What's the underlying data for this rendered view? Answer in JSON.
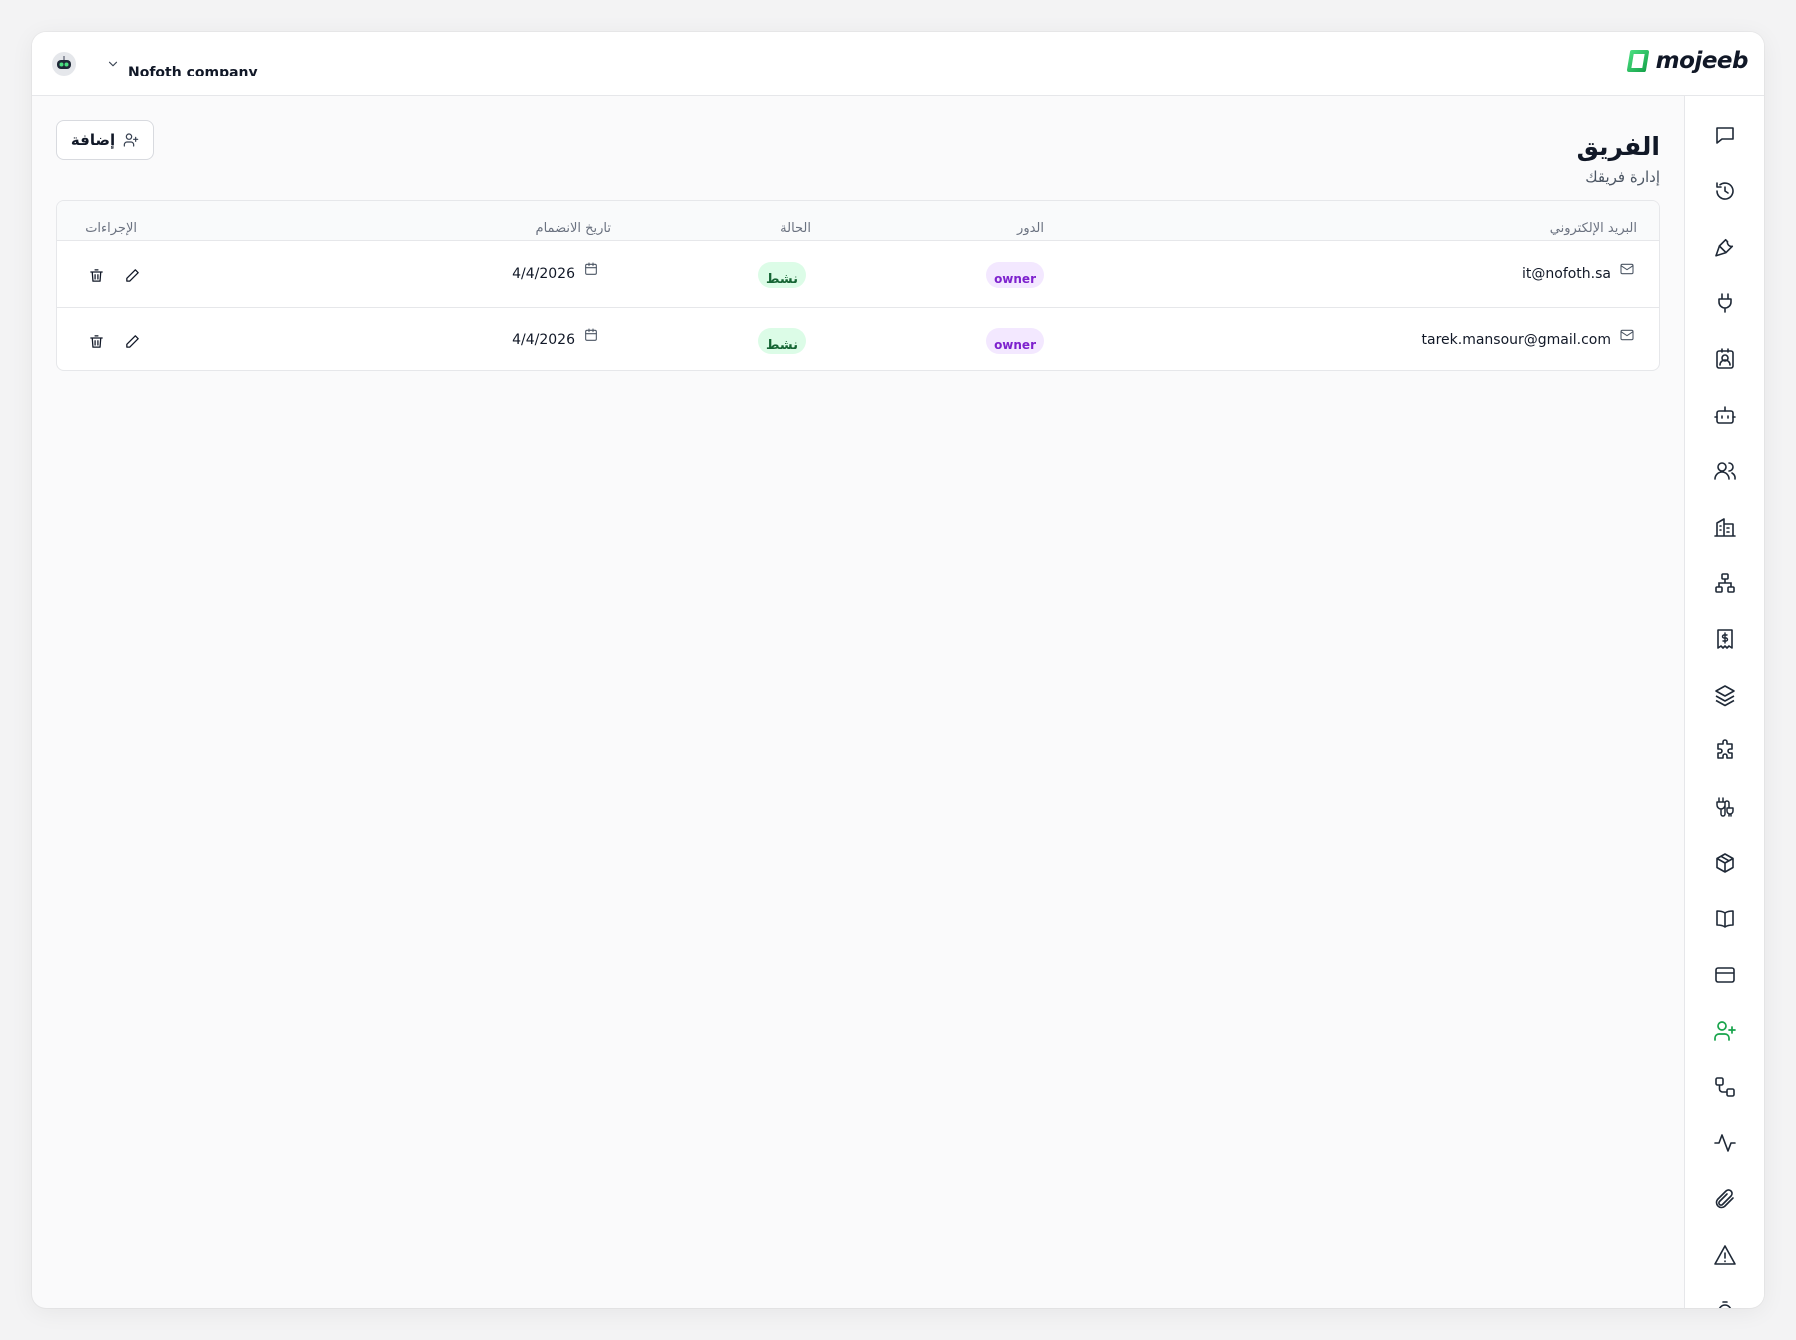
{
  "colors": {
    "accent": "#22c55e",
    "role_badge_bg": "#f3e8ff",
    "role_badge_text": "#7e22ce",
    "status_badge_bg": "#dcfce7",
    "status_badge_text": "#166534"
  },
  "header": {
    "org_name": "Nofoth company",
    "brand_name": "mojeeb"
  },
  "page": {
    "title": "الفريق",
    "subtitle": "إدارة فريقك",
    "add_label": "إضافة"
  },
  "table": {
    "columns": {
      "email": "البريد الإلكتروني",
      "role": "الدور",
      "status": "الحالة",
      "joined": "تاريخ الانضمام",
      "actions": "الإجراءات"
    },
    "rows": [
      {
        "email": "it@nofoth.sa",
        "role": "owner",
        "status": "نشط",
        "date": "4/4/2026"
      },
      {
        "email": "tarek.mansour@gmail.com",
        "role": "owner",
        "status": "نشط",
        "date": "4/4/2026"
      }
    ]
  },
  "sidebar": {
    "active_item": "team",
    "items": [
      "chat-icon",
      "history-icon",
      "wrench-icon",
      "plug-icon",
      "contact-icon",
      "bot-icon",
      "users-icon",
      "building-icon",
      "sitemap-icon",
      "receipt-icon",
      "layers-icon",
      "puzzle-icon",
      "cable-icon",
      "package-icon",
      "book-icon",
      "credit-card-icon",
      "user-plus-icon",
      "workflow-icon",
      "activity-icon",
      "paperclip-icon",
      "alert-triangle-icon"
    ]
  }
}
